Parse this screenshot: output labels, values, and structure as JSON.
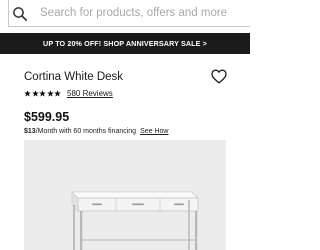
{
  "search": {
    "placeholder": "Search for products, offers and more"
  },
  "promo": {
    "text": "UP TO 20% OFF! SHOP ANNIVERSARY SALE >"
  },
  "product": {
    "title": "Cortina White Desk",
    "rating": 5,
    "reviews_label": "580 Reviews",
    "price": "$599.95",
    "financing_amount": "$13",
    "financing_text": "/Month with 60 months financing",
    "see_how_label": "See How"
  },
  "icons": {
    "search": "search-icon",
    "favorite": "heart-outline-icon",
    "star": "star-icon"
  },
  "colors": {
    "promo_background": "#1b1b1b",
    "image_background": "#ececec"
  }
}
